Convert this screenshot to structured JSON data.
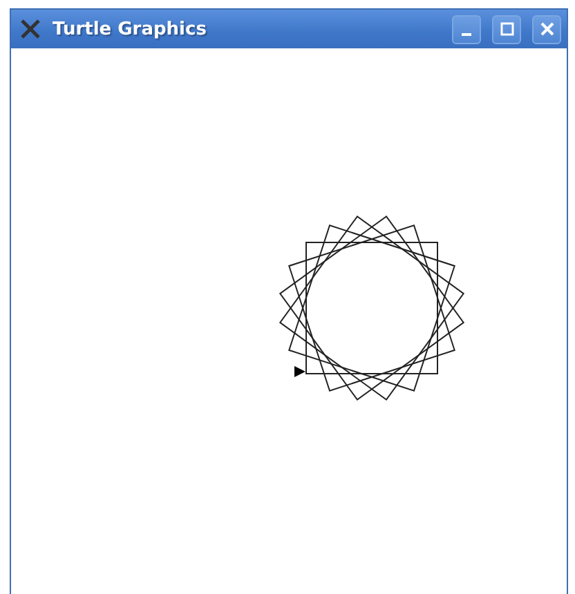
{
  "window": {
    "title": "Turtle Graphics"
  }
}
